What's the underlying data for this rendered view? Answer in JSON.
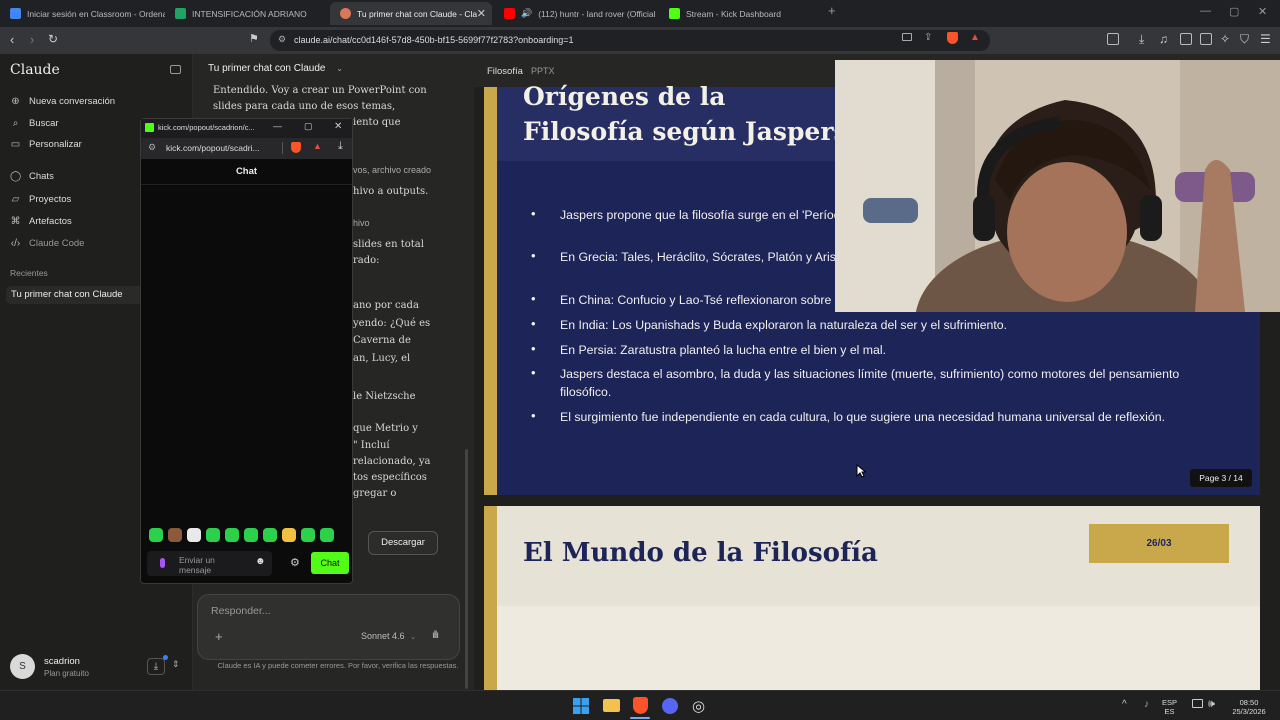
{
  "browser": {
    "tabs": [
      {
        "label": "Iniciar sesión en Classroom - Ordena",
        "color": "#4285f4"
      },
      {
        "label": "INTENSIFICACIÓN ADRIANO",
        "color": "#1fa463"
      },
      {
        "label": "Tu primer chat con Claude - Cla",
        "color": "#d97757",
        "active": true
      },
      {
        "label": "(112) huntr - land rover (Official",
        "color": "#ff0000"
      },
      {
        "label": "Stream - Kick Dashboard",
        "color": "#53fc18"
      }
    ],
    "new_tab": "+",
    "url": "claude.ai/chat/cc0d146f-57d8-450b-bf15-5699f77f2783?onboarding=1"
  },
  "sidebar": {
    "brand": "Claude",
    "nav": [
      {
        "label": "Nueva conversación",
        "icon": "plus-icon"
      },
      {
        "label": "Buscar",
        "icon": "search-icon"
      },
      {
        "label": "Personalizar",
        "icon": "customize-icon"
      },
      {
        "label": "Chats",
        "icon": "chat-icon"
      },
      {
        "label": "Proyectos",
        "icon": "folder-icon"
      },
      {
        "label": "Artefactos",
        "icon": "artifacts-icon"
      },
      {
        "label": "Claude Code",
        "icon": "code-icon"
      }
    ],
    "recent_label": "Recientes",
    "recent_chat": "Tu primer chat con Claude",
    "user": {
      "initial": "S",
      "name": "scadrion",
      "plan": "Plan gratuito"
    }
  },
  "chat": {
    "title": "Tu primer chat con Claude",
    "message_lines_top": [
      "Entendido. Voy a crear un PowerPoint con",
      "slides para cada uno de esos temas,",
      "iento que"
    ],
    "message_fragments": [
      "vos, archivo creado",
      "hivo a outputs.",
      "hivo",
      "slides en total",
      "rado:",
      "ano por cada",
      "yendo: ¿Qué es",
      "Caverna de",
      "an, Lucy, el",
      "le Nietzsche",
      "que Metrio y",
      "\" Incluí",
      "relacionado, ya",
      "tos específicos",
      "gregar o"
    ],
    "download_label": "Descargar",
    "composer_placeholder": "Responder...",
    "model": "Sonnet 4.6",
    "disclaimer": "Claude es IA y puede cometer errores. Por favor, verifica las respuestas."
  },
  "kick": {
    "window_title": "kick.com/popout/scadrion/c...",
    "url": "kick.com/popout/scadri...",
    "chat_header": "Chat",
    "input_placeholder": "Enviar un mensaje",
    "chat_button": "Chat",
    "emote_colors": [
      "#2bd14a",
      "#8a5a3a",
      "#e9e9e9",
      "#2bd14a",
      "#2bd14a",
      "#2bd14a",
      "#2bd14a",
      "#f0c040",
      "#2bd14a",
      "#2bd14a"
    ]
  },
  "artifact": {
    "name": "Filosofía",
    "type": "PPTX",
    "slide1": {
      "title": "Orígenes de la Filosofía según Jaspers",
      "bullets": [
        "Jaspers propone que la filosofía surge en el 'Período Axial' en varias culturas.",
        "En Grecia: Tales, Heráclito, Sócrates, Platón y Aristóteles buscaron explicaciones racionales.",
        "En China: Confucio y Lao-Tsé reflexionaron sobre la armonía y la ética.",
        "En India: Los Upanishads y Buda exploraron la naturaleza del ser y el sufrimiento.",
        "En Persia: Zaratustra planteó la lucha entre el bien y el mal.",
        "Jaspers destaca el asombro, la duda y las situaciones límite (muerte, sufrimiento) como motores del pensamiento filosófico.",
        "El surgimiento fue independiente en cada cultura, lo que sugiere una necesidad humana universal de reflexión."
      ],
      "page": "Page 3 / 14"
    },
    "slide2": {
      "title": "El Mundo de la Filosofía",
      "date": "26/03"
    }
  },
  "taskbar": {
    "lang": [
      "ESP",
      "ES"
    ],
    "time": "08:50",
    "date": "25/3/2026"
  }
}
